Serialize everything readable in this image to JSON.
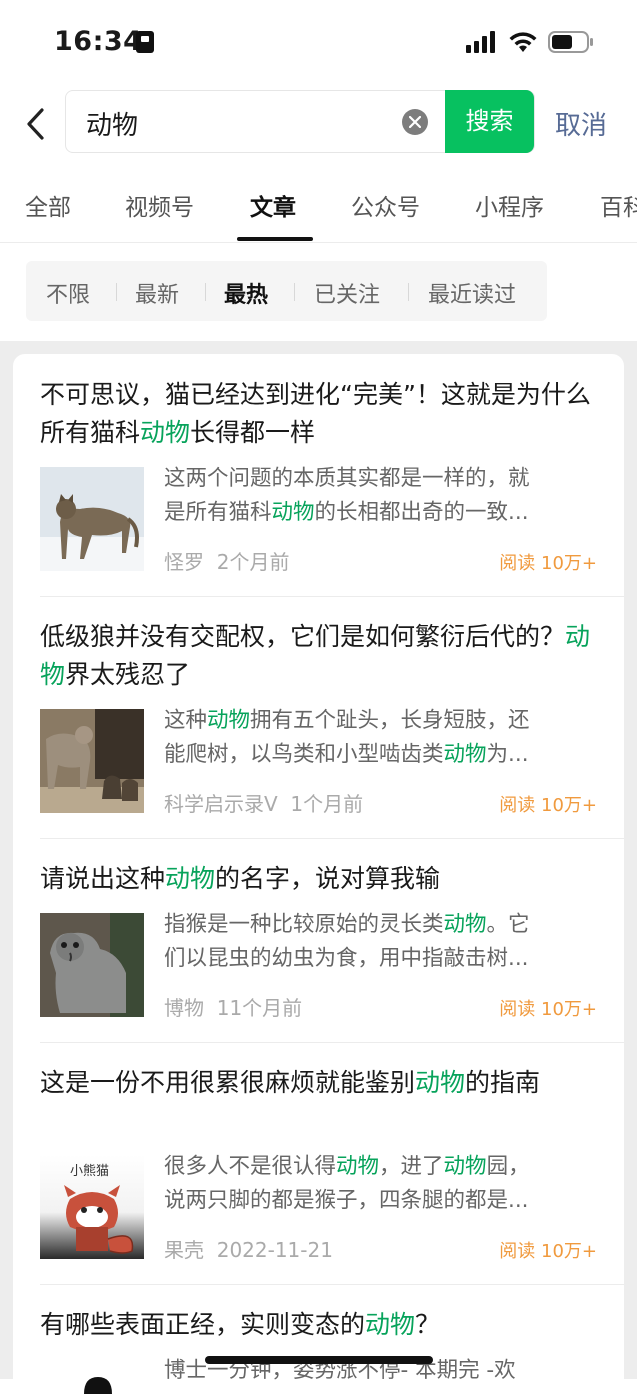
{
  "status_bar": {
    "time": "16:34"
  },
  "search": {
    "query": "动物",
    "button_label": "搜索",
    "cancel_label": "取消"
  },
  "tabs": [
    "全部",
    "视频号",
    "文章",
    "公众号",
    "小程序",
    "百科"
  ],
  "active_tab": "文章",
  "filters": [
    "不限",
    "最新",
    "最热",
    "已关注",
    "最近读过"
  ],
  "active_filter": "最热",
  "results": [
    {
      "title_parts": [
        "不可思议，猫已经达到进化“完美”！这就是为什么所有猫科",
        "动物",
        "长得都一样"
      ],
      "desc_line1_parts": [
        "这两个问题的本质其实都是一样的，就"
      ],
      "desc_line2_parts": [
        "是所有猫科",
        "动物",
        "的长相都出奇的一致..."
      ],
      "author": "怪罗",
      "time": "2个月前",
      "reads": "阅读 10万+"
    },
    {
      "title_parts": [
        "低级狼并没有交配权，它们是如何繁衍后代的？",
        "动物",
        "界太残忍了"
      ],
      "desc_line1_parts": [
        "这种",
        "动物",
        "拥有五个趾头，长身短肢，还"
      ],
      "desc_line2_parts": [
        "能爬树，以鸟类和小型啮齿类",
        "动物",
        "为..."
      ],
      "author": "科学启示录V",
      "time": "1个月前",
      "reads": "阅读 10万+"
    },
    {
      "title_parts": [
        "请说出这种",
        "动物",
        "的名字，说对算我输"
      ],
      "desc_line1_parts": [
        "指猴是一种比较原始的灵长类",
        "动物",
        "。它"
      ],
      "desc_line2_parts": [
        "们以昆虫的幼虫为食，用中指敲击树..."
      ],
      "author": "博物",
      "time": "11个月前",
      "reads": "阅读 10万+"
    },
    {
      "title_parts": [
        "这是一份不用很累很麻烦就能鉴别",
        "动物",
        "的指南"
      ],
      "desc_line1_parts": [
        "很多人不是很认得",
        "动物",
        "，进了",
        "动物",
        "园，"
      ],
      "desc_line2_parts": [
        "说两只脚的都是猴子，四条腿的都是..."
      ],
      "author": "果壳",
      "time": "2022-11-21",
      "reads": "阅读 10万+",
      "thumb_caption": "小熊猫"
    },
    {
      "title_parts": [
        "有哪些表面正经，实则变态的",
        "动物",
        "？"
      ],
      "desc_line1_parts": [
        "博士一分钟，姿势涨不停- 本期完 -欢"
      ]
    }
  ],
  "colors": {
    "accent_green": "#07c160",
    "highlight_green": "#07a35b",
    "link_blue": "#576b95",
    "read_orange": "#f09a3e"
  }
}
